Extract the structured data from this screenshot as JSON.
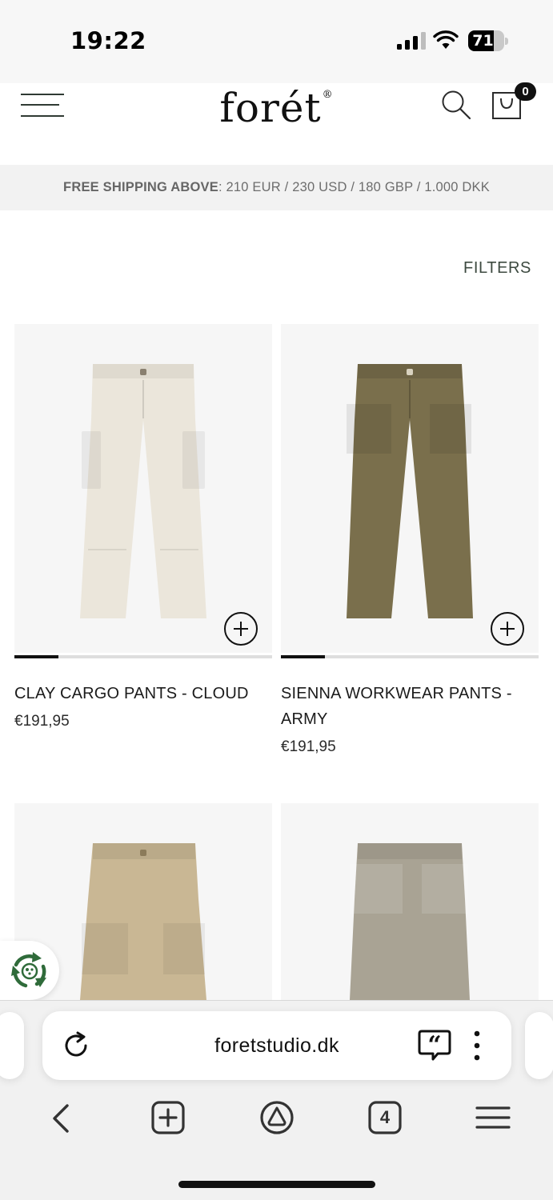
{
  "status_bar": {
    "time": "19:22",
    "battery_percent": "71",
    "battery_level": 0.71,
    "signal_icon": "cellular-signal-icon",
    "wifi_icon": "wifi-icon"
  },
  "header": {
    "logo_text": "forét",
    "logo_mark": "®",
    "menu_icon": "hamburger-menu-icon",
    "search_icon": "search-icon",
    "cart_icon": "shopping-bag-icon",
    "cart_count": "0"
  },
  "shipping_banner": {
    "label": "FREE SHIPPING ABOVE",
    "value": ": 210 EUR / 230 USD / 180 GBP / 1.000 DKK"
  },
  "filters_label": "FILTERS",
  "products": [
    {
      "name": "CLAY CARGO PANTS - CLOUD",
      "price": "€191,95",
      "color": "#ebe6db",
      "gallery_position": 0.17
    },
    {
      "name": "SIENNA WORKWEAR PANTS - ARMY",
      "price": "€191,95",
      "color": "#7a6f4c",
      "gallery_position": 0.17
    },
    {
      "name": "",
      "price": "",
      "color": "#c9b794"
    },
    {
      "name": "",
      "price": "",
      "color": "#a9a394"
    }
  ],
  "floating_badge": {
    "icon": "recycle-icon",
    "color": "#2f6b3a"
  },
  "browser": {
    "url": "foretstudio.dk",
    "reload_icon": "reload-icon",
    "quote_icon": "quote-icon",
    "more_icon": "more-vertical-icon",
    "tab_count": "4",
    "nav": [
      "back-icon",
      "new-tab-icon",
      "home-icon",
      "tabs-icon",
      "menu-icon"
    ]
  }
}
